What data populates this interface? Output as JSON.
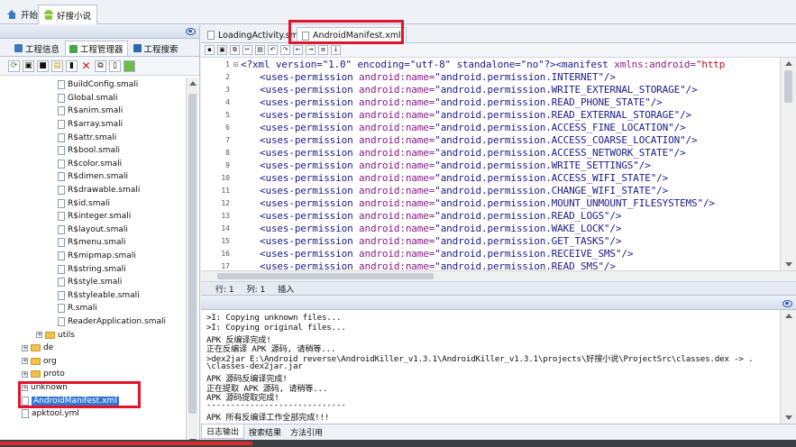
{
  "top_tabs": [
    {
      "label": "开始",
      "icon": "home-icon"
    },
    {
      "label": "好搜小说",
      "icon": "android-icon"
    }
  ],
  "left_tabs": [
    {
      "label": "工程信息",
      "color": "#3a78c4"
    },
    {
      "label": "工程管理器",
      "color": "#45a845"
    },
    {
      "label": "工程搜索",
      "color": "#2a6ab0"
    }
  ],
  "tree": [
    {
      "label": "BuildConfig.smali",
      "type": "file"
    },
    {
      "label": "Global.smali",
      "type": "file"
    },
    {
      "label": "R$anim.smali",
      "type": "file"
    },
    {
      "label": "R$array.smali",
      "type": "file"
    },
    {
      "label": "R$attr.smali",
      "type": "file"
    },
    {
      "label": "R$bool.smali",
      "type": "file"
    },
    {
      "label": "R$color.smali",
      "type": "file"
    },
    {
      "label": "R$dimen.smali",
      "type": "file"
    },
    {
      "label": "R$drawable.smali",
      "type": "file"
    },
    {
      "label": "R$id.smali",
      "type": "file"
    },
    {
      "label": "R$integer.smali",
      "type": "file"
    },
    {
      "label": "R$layout.smali",
      "type": "file"
    },
    {
      "label": "R$menu.smali",
      "type": "file"
    },
    {
      "label": "R$mipmap.smali",
      "type": "file"
    },
    {
      "label": "R$string.smali",
      "type": "file"
    },
    {
      "label": "R$style.smali",
      "type": "file"
    },
    {
      "label": "R$styleable.smali",
      "type": "file"
    },
    {
      "label": "R.smali",
      "type": "file"
    },
    {
      "label": "ReaderApplication.smali",
      "type": "file"
    },
    {
      "label": "utils",
      "type": "folder"
    },
    {
      "label": "de",
      "type": "folder"
    },
    {
      "label": "org",
      "type": "folder"
    },
    {
      "label": "proto",
      "type": "folder"
    },
    {
      "label": "unknown",
      "type": "folder"
    },
    {
      "label": "AndroidManifest.xml",
      "type": "file",
      "selected": true
    },
    {
      "label": "apktool.yml",
      "type": "file"
    }
  ],
  "editor_tabs": [
    {
      "label": "LoadingActivity.sm"
    },
    {
      "label": "AndroidManifest.xml",
      "active": true
    }
  ],
  "code_header": {
    "prolog": "<?xml version=\"1.0\" encoding=\"utf-8\" standalone=\"no\"?><manifest ",
    "attr": "xmlns:android=",
    "attr_value": "\"http"
  },
  "permissions": [
    "android.permission.INTERNET",
    "android.permission.WRITE_EXTERNAL_STORAGE",
    "android.permission.READ_PHONE_STATE",
    "android.permission.READ_EXTERNAL_STORAGE",
    "android.permission.ACCESS_FINE_LOCATION",
    "android.permission.ACCESS_COARSE_LOCATION",
    "android.permission.ACCESS_NETWORK_STATE",
    "android.permission.WRITE_SETTINGS",
    "android.permission.ACCESS_WIFI_STATE",
    "android.permission.CHANGE_WIFI_STATE",
    "android.permission.MOUNT_UNMOUNT_FILESYSTEMS",
    "android.permission.READ_LOGS",
    "android.permission.WAKE_LOCK",
    "android.permission.GET_TASKS",
    "android.permission.RECEIVE_SMS",
    "android.permission.READ_SMS"
  ],
  "permission_tag": "<uses-permission ",
  "permission_attr": "android:name=",
  "status": {
    "row": "行: 1",
    "col": "列: 1",
    "mode": "插入"
  },
  "log_lines": [
    ">I: Copying unknown files...",
    ">I: Copying original files...",
    "APK 反编译完成!",
    "正在反编译 APK 源码, 请稍等...",
    ">dex2jar E:\\Android reverse\\AndroidKiller_v1.3.1\\AndroidKiller_v1.3.1\\projects\\好搜小说\\ProjectSrc\\classes.dex -> .",
    "\\classes-dex2jar.jar",
    "APK 源码反编译完成!",
    "正在提取 APK 源码, 请稍等...",
    "APK 源码提取完成!",
    "-----------------------------",
    "APK 所有反编译工作全部完成!!!"
  ],
  "bottom_tabs": [
    "日志输出",
    "搜索结果",
    "方法引用"
  ]
}
